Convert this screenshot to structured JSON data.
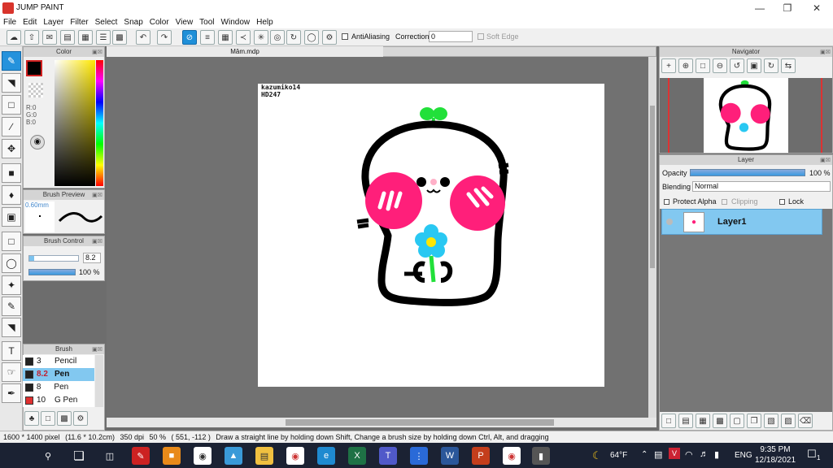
{
  "app": {
    "title": "JUMP PAINT"
  },
  "menu": [
    "File",
    "Edit",
    "Layer",
    "Filter",
    "Select",
    "Snap",
    "Color",
    "View",
    "Tool",
    "Window",
    "Help"
  ],
  "toolbar": {
    "antialias_label": "AntiAliasing",
    "correction_label": "Correction",
    "correction_value": "0",
    "soft_edge_label": "Soft Edge"
  },
  "color_panel": {
    "title": "Color",
    "r": "R:0",
    "g": "G:0",
    "b": "B:0",
    "fg_color": "#000000",
    "bg_color": "#ffffff"
  },
  "brush_preview": {
    "title": "Brush Preview",
    "size": "0.60mm"
  },
  "brush_control": {
    "title": "Brush Control",
    "size_value": "8.2",
    "opacity_value": "100 %"
  },
  "brush_panel": {
    "title": "Brush",
    "items": [
      {
        "size": "3",
        "name": "Pencil",
        "color": "#222222"
      },
      {
        "size": "8.2",
        "name": "Pen",
        "color": "#222222",
        "selected": true
      },
      {
        "size": "8",
        "name": "Pen (Sharp",
        "color": "#222222"
      },
      {
        "size": "10",
        "name": "G Pen",
        "color": "#e03030"
      }
    ]
  },
  "document": {
    "tab": "Mâm.mdp",
    "signature_line1": "kazumiko14",
    "signature_line2": "HD247"
  },
  "navigator": {
    "title": "Navigator"
  },
  "layer_panel": {
    "title": "Layer",
    "opacity_label": "Opacity",
    "opacity_value": "100 %",
    "blending_label": "Blending",
    "blending_value": "Normal",
    "protect_alpha": "Protect Alpha",
    "clipping": "Clipping",
    "lock": "Lock",
    "layer_name": "Layer1"
  },
  "status": {
    "size": "1600 * 1400 pixel",
    "cm": "(11.6 * 10.2cm)",
    "dpi": "350 dpi",
    "zoom": "50 %",
    "coords": "( 551, -112 )",
    "hint": "Draw a straight line by holding down Shift, Change a brush size by holding down Ctrl, Alt, and dragging"
  },
  "taskbar": {
    "weather": "64°F",
    "lang": "ENG",
    "time": "9:35 PM",
    "date": "12/18/2021",
    "notif": "1"
  }
}
